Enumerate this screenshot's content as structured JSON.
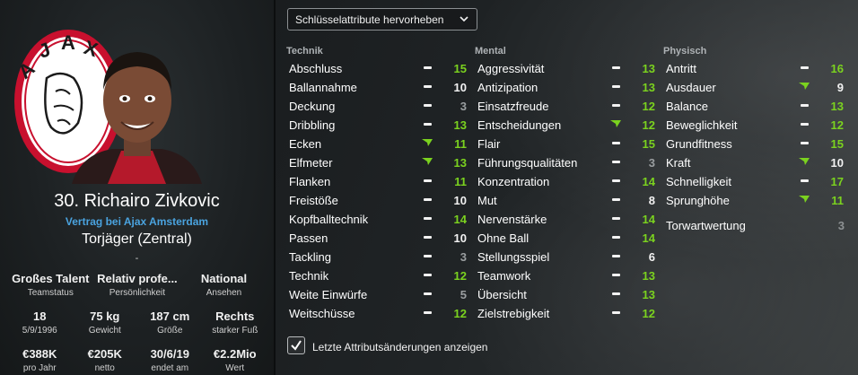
{
  "player": {
    "name": "30. Richairo Zivkovic",
    "contract": "Vertrag bei Ajax Amsterdam",
    "position": "Torjäger (Zentral)",
    "separator": "-"
  },
  "info": [
    [
      {
        "value": "Großes Talent",
        "label": "Teamstatus"
      },
      {
        "value": "Relativ profe...",
        "label": "Persönlichkeit"
      },
      {
        "value": "National",
        "label": "Ansehen"
      }
    ],
    [
      {
        "value": "18",
        "label": "5/9/1996"
      },
      {
        "value": "75 kg",
        "label": "Gewicht"
      },
      {
        "value": "187 cm",
        "label": "Größe"
      },
      {
        "value": "Rechts",
        "label": "starker Fuß"
      }
    ],
    [
      {
        "value": "€388K",
        "label": "pro Jahr"
      },
      {
        "value": "€205K",
        "label": "netto"
      },
      {
        "value": "30/6/19",
        "label": "endet am"
      },
      {
        "value": "€2.2Mio",
        "label": "Wert"
      }
    ]
  ],
  "highlight_dropdown": {
    "label": "Schlüsselattribute hervorheben"
  },
  "columns": [
    {
      "header": "Technik",
      "attributes": [
        {
          "name": "Abschluss",
          "trend": "flat",
          "value": "15"
        },
        {
          "name": "Ballannahme",
          "trend": "flat",
          "value": "10"
        },
        {
          "name": "Deckung",
          "trend": "flat",
          "value": "3"
        },
        {
          "name": "Dribbling",
          "trend": "flat",
          "value": "13"
        },
        {
          "name": "Ecken",
          "trend": "up",
          "value": "11"
        },
        {
          "name": "Elfmeter",
          "trend": "up",
          "value": "13"
        },
        {
          "name": "Flanken",
          "trend": "flat",
          "value": "11"
        },
        {
          "name": "Freistöße",
          "trend": "flat",
          "value": "10"
        },
        {
          "name": "Kopfballtechnik",
          "trend": "flat",
          "value": "14"
        },
        {
          "name": "Passen",
          "trend": "flat",
          "value": "10"
        },
        {
          "name": "Tackling",
          "trend": "flat",
          "value": "3"
        },
        {
          "name": "Technik",
          "trend": "flat",
          "value": "12"
        },
        {
          "name": "Weite Einwürfe",
          "trend": "flat",
          "value": "5"
        },
        {
          "name": "Weitschüsse",
          "trend": "flat",
          "value": "12"
        }
      ]
    },
    {
      "header": "Mental",
      "attributes": [
        {
          "name": "Aggressivität",
          "trend": "flat",
          "value": "13"
        },
        {
          "name": "Antizipation",
          "trend": "flat",
          "value": "13"
        },
        {
          "name": "Einsatzfreude",
          "trend": "flat",
          "value": "12"
        },
        {
          "name": "Entscheidungen",
          "trend": "up",
          "value": "12"
        },
        {
          "name": "Flair",
          "trend": "flat",
          "value": "15"
        },
        {
          "name": "Führungsqualitäten",
          "trend": "flat",
          "value": "3"
        },
        {
          "name": "Konzentration",
          "trend": "flat",
          "value": "14"
        },
        {
          "name": "Mut",
          "trend": "flat",
          "value": "8"
        },
        {
          "name": "Nervenstärke",
          "trend": "flat",
          "value": "14"
        },
        {
          "name": "Ohne Ball",
          "trend": "flat",
          "value": "14"
        },
        {
          "name": "Stellungsspiel",
          "trend": "flat",
          "value": "6"
        },
        {
          "name": "Teamwork",
          "trend": "flat",
          "value": "13"
        },
        {
          "name": "Übersicht",
          "trend": "flat",
          "value": "13"
        },
        {
          "name": "Zielstrebigkeit",
          "trend": "flat",
          "value": "12"
        }
      ]
    },
    {
      "header": "Physisch",
      "attributes": [
        {
          "name": "Antritt",
          "trend": "flat",
          "value": "16"
        },
        {
          "name": "Ausdauer",
          "trend": "up",
          "value": "9"
        },
        {
          "name": "Balance",
          "trend": "flat",
          "value": "13"
        },
        {
          "name": "Beweglichkeit",
          "trend": "flat",
          "value": "12"
        },
        {
          "name": "Grundfitness",
          "trend": "flat",
          "value": "15"
        },
        {
          "name": "Kraft",
          "trend": "up",
          "value": "10"
        },
        {
          "name": "Schnelligkeit",
          "trend": "flat",
          "value": "17"
        },
        {
          "name": "Sprunghöhe",
          "trend": "up",
          "value": "11"
        }
      ]
    }
  ],
  "goalkeeper_rating": {
    "name": "Torwartwertung",
    "value": "3"
  },
  "changes_toggle": {
    "label": "Letzte Attributsänderungen anzeigen",
    "checked": true
  },
  "colors": {
    "high": "#7bd21f",
    "mid": "#f2f2f2",
    "low": "#9a9ea0",
    "link": "#4aa3df",
    "trend_up": "#7bd21f"
  }
}
